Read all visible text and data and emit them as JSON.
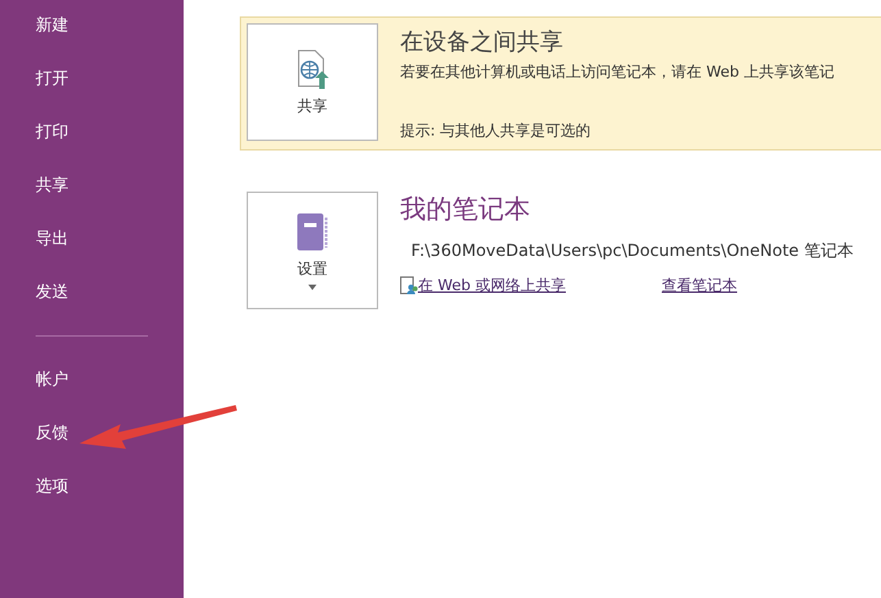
{
  "sidebar": {
    "items": [
      {
        "label": "新建",
        "selected": false
      },
      {
        "label": "打开",
        "selected": false
      },
      {
        "label": "打印",
        "selected": false
      },
      {
        "label": "共享",
        "selected": false
      },
      {
        "label": "导出",
        "selected": false
      },
      {
        "label": "发送",
        "selected": false
      }
    ],
    "lower_items": [
      {
        "label": "帐户",
        "selected": false
      },
      {
        "label": "反馈",
        "selected": false
      },
      {
        "label": "选项",
        "selected": false
      }
    ]
  },
  "share_card": {
    "button": "共享",
    "title": "在设备之间共享",
    "description": "若要在其他计算机或电话上访问笔记本，请在 Web 上共享该笔记",
    "tip": "提示: 与其他人共享是可选的"
  },
  "notebook": {
    "button": "设置",
    "title": "我的笔记本",
    "path": "F:\\360MoveData\\Users\\pc\\Documents\\OneNote 笔记本",
    "share_link": "在 Web 或网络上共享",
    "view_link": "查看笔记本"
  }
}
